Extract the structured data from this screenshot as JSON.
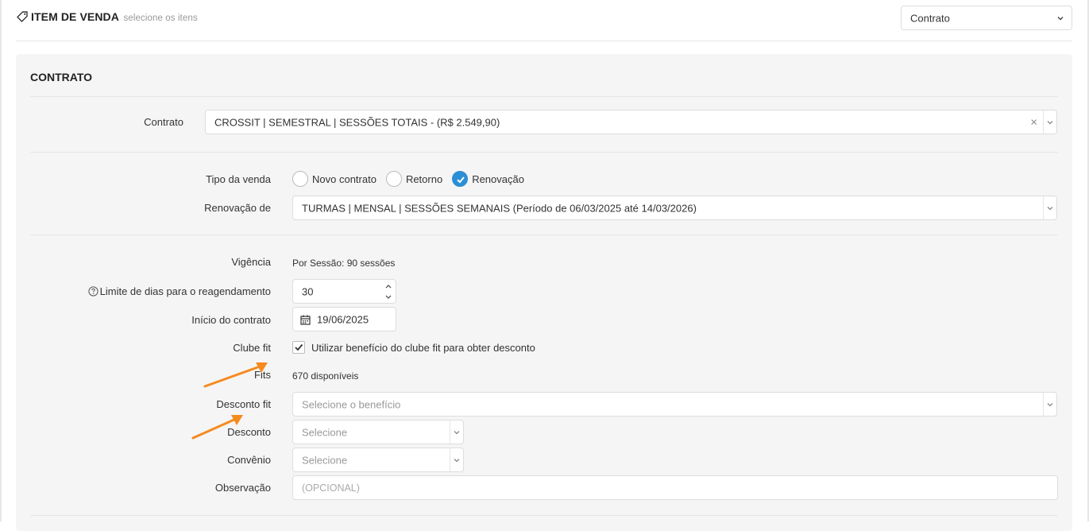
{
  "header": {
    "title": "ITEM DE VENDA",
    "subtitle": "selecione os itens",
    "type_select_value": "Contrato"
  },
  "panel": {
    "title": "CONTRATO"
  },
  "contrato": {
    "label": "Contrato",
    "value": "CROSSIT | SEMESTRAL | SESSÕES TOTAIS - (R$ 2.549,90)",
    "clear": "×"
  },
  "tipo_venda": {
    "label": "Tipo da venda",
    "options": [
      {
        "label": "Novo contrato",
        "checked": false
      },
      {
        "label": "Retorno",
        "checked": false
      },
      {
        "label": "Renovação",
        "checked": true
      }
    ]
  },
  "renovacao": {
    "label": "Renovação de",
    "value": "TURMAS | MENSAL | SESSÕES SEMANAIS (Período de 06/03/2025 até 14/03/2026)"
  },
  "vigencia": {
    "label": "Vigência",
    "value": "Por Sessão: 90 sessões"
  },
  "limite": {
    "label": "Limite de dias para o reagendamento",
    "value": "30"
  },
  "inicio": {
    "label": "Início do contrato",
    "value": "19/06/2025"
  },
  "clube": {
    "label": "Clube fit",
    "checkbox_label": "Utilizar benefício do clube fit para obter desconto",
    "checked": true
  },
  "fits": {
    "label": "Fits",
    "value": "670 disponíveis"
  },
  "desconto_fit": {
    "label": "Desconto fit",
    "placeholder": "Selecione o benefício"
  },
  "desconto": {
    "label": "Desconto",
    "placeholder": "Selecione"
  },
  "convenio": {
    "label": "Convênio",
    "placeholder": "Selecione"
  },
  "observacao": {
    "label": "Observação",
    "placeholder": "(OPCIONAL)"
  },
  "colors": {
    "accent": "#2b8fd6",
    "annotation_arrow": "#f58a1f",
    "panel_bg": "#f5f5f5"
  }
}
